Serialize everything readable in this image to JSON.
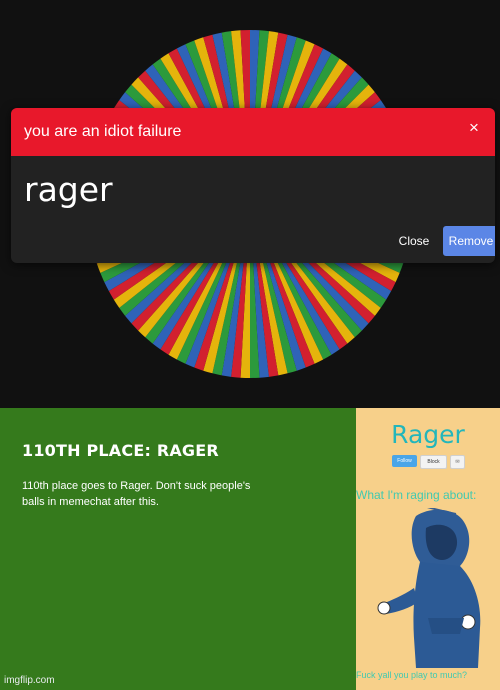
{
  "modal": {
    "title": "you are an idiot failure",
    "close_icon": "×",
    "name": "rager",
    "close_label": "Close",
    "remove_label": "Remove"
  },
  "wheel": {
    "segment_colors": [
      "#d2202f",
      "#2f63b8",
      "#2c9a3c",
      "#e5b40c"
    ]
  },
  "placement": {
    "title": "110TH PLACE: RAGER",
    "description": "110th place goes to Rager. Don't suck people's balls in memechat after this."
  },
  "profile_card": {
    "name": "Rager",
    "follow_label": "Follow",
    "block_label": "Block",
    "mail_icon": "✉",
    "heading": "What I'm raging about:",
    "footer": "Fuck yall you play to much?"
  },
  "watermark": "imgflip.com"
}
